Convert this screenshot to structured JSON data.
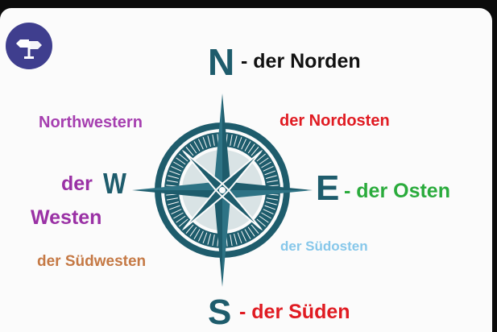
{
  "icons": {
    "logo": "signpost-arrows-icon"
  },
  "colors": {
    "compass": "#1e5c6c",
    "north_label": "#111111",
    "east_label": "#2aab3c",
    "south_label": "#e01b22",
    "northeast_label": "#e01b22",
    "northwest_label": "#a63fb0",
    "west_label": "#9a31a5",
    "southwest_label": "#c57945",
    "southeast_label": "#86c7ea"
  },
  "compass": {
    "north": {
      "letter": "N",
      "label": "- der Norden"
    },
    "east": {
      "letter": "E",
      "label": "- der Osten"
    },
    "south": {
      "letter": "S",
      "label": "- der Süden"
    },
    "west": {
      "letter": "W",
      "label_line1": "der",
      "label_line2": "Westen"
    },
    "northeast": {
      "label": "der Nordosten"
    },
    "northwest": {
      "label": "Northwestern"
    },
    "southeast": {
      "label": "der Südosten"
    },
    "southwest": {
      "label": "der Südwesten"
    }
  }
}
